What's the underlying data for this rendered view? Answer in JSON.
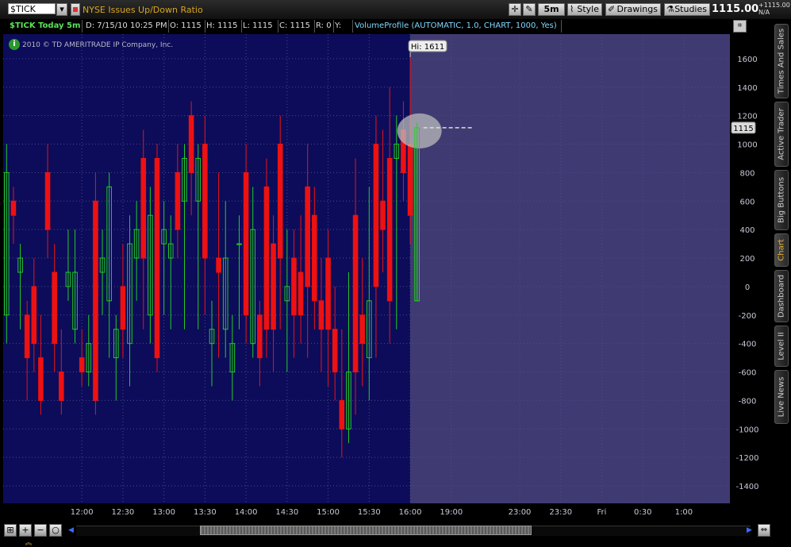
{
  "topbar": {
    "symbol": "$TICK",
    "study_title": "NYSE Issues Up/Down Ratio",
    "period_button": "5m",
    "style_button": "Style",
    "drawings_button": "Drawings",
    "studies_button": "Studies",
    "last_price": "1115.00",
    "change": "+1115.00",
    "change_pct": "N/A"
  },
  "infobar": {
    "title": "$TICK Today 5m",
    "date": "D: 7/15/10 10:25 PM",
    "open": "O: 1115",
    "high": "H: 1115",
    "low": "L: 1115",
    "close": "C: 1115",
    "range": "R: 0",
    "y": "Y:",
    "study": "VolumeProfile (AUTOMATIC, 1.0, CHART, 1000, Yes)"
  },
  "chart": {
    "copyright": "2010 © TD AMERITRADE IP Company, Inc.",
    "hi_label": "Hi: 1611",
    "price_badge": "1115",
    "colors": {
      "background": "#0c0c5a",
      "future": "#3f3b72",
      "up": "#22cc22",
      "down": "#ee1111",
      "axis_text": "#c8c8d8"
    }
  },
  "chart_data": {
    "type": "candlestick",
    "ylim": [
      -1500,
      1750
    ],
    "y_ticks": [
      1600,
      1400,
      1200,
      1000,
      800,
      600,
      400,
      200,
      0,
      -200,
      -400,
      -600,
      -800,
      -1000,
      -1200,
      -1400
    ],
    "x_ticks": [
      {
        "label": "12:00",
        "slot": 11
      },
      {
        "label": "12:30",
        "slot": 17
      },
      {
        "label": "13:00",
        "slot": 23
      },
      {
        "label": "13:30",
        "slot": 29
      },
      {
        "label": "14:00",
        "slot": 35
      },
      {
        "label": "14:30",
        "slot": 41
      },
      {
        "label": "15:00",
        "slot": 47
      },
      {
        "label": "15:30",
        "slot": 53
      },
      {
        "label": "16:00",
        "slot": 59
      },
      {
        "label": "19:00",
        "slot": 65
      },
      {
        "label": "23:00",
        "slot": 75
      },
      {
        "label": "23:30",
        "slot": 81
      },
      {
        "label": "Fri",
        "slot": 87
      },
      {
        "label": "0:30",
        "slot": 93
      },
      {
        "label": "1:00",
        "slot": 99
      }
    ],
    "session_end_slot": 59.5,
    "total_slots": 106,
    "hi": 1611,
    "last": 1115,
    "candles": [
      [
        -200,
        800,
        -400,
        1000
      ],
      [
        600,
        500,
        300,
        700
      ],
      [
        100,
        200,
        -300,
        300
      ],
      [
        -200,
        -500,
        -800,
        -100
      ],
      [
        0,
        -400,
        -600,
        200
      ],
      [
        -500,
        -800,
        -900,
        -200
      ],
      [
        800,
        400,
        200,
        1000
      ],
      [
        100,
        -400,
        -600,
        300
      ],
      [
        -600,
        -800,
        -900,
        -300
      ],
      [
        0,
        100,
        -100,
        400
      ],
      [
        -300,
        100,
        -400,
        400
      ],
      [
        -500,
        -600,
        -700,
        -300
      ],
      [
        -600,
        -400,
        -700,
        -200
      ],
      [
        600,
        -800,
        -900,
        800
      ],
      [
        100,
        200,
        -200,
        400
      ],
      [
        -100,
        700,
        -500,
        800
      ],
      [
        -500,
        -300,
        -800,
        -200
      ],
      [
        0,
        -300,
        -500,
        300
      ],
      [
        -400,
        300,
        -700,
        500
      ],
      [
        200,
        400,
        -100,
        600
      ],
      [
        900,
        200,
        -300,
        1100
      ],
      [
        -200,
        500,
        -400,
        700
      ],
      [
        900,
        -500,
        -600,
        1000
      ],
      [
        300,
        400,
        -200,
        600
      ],
      [
        200,
        300,
        -300,
        500
      ],
      [
        800,
        400,
        200,
        1000
      ],
      [
        600,
        900,
        -300,
        1000
      ],
      [
        1200,
        800,
        500,
        1300
      ],
      [
        600,
        900,
        -300,
        1000
      ],
      [
        1000,
        200,
        -200,
        1200
      ],
      [
        -400,
        -300,
        -700,
        -100
      ],
      [
        200,
        100,
        -500,
        800
      ],
      [
        -300,
        200,
        -500,
        600
      ],
      [
        -600,
        -400,
        -800,
        -200
      ],
      [
        300,
        300,
        -300,
        500
      ],
      [
        800,
        -200,
        -400,
        1000
      ],
      [
        -400,
        400,
        -500,
        700
      ],
      [
        -200,
        -500,
        -700,
        -100
      ],
      [
        700,
        -300,
        -500,
        900
      ],
      [
        300,
        -300,
        -600,
        500
      ],
      [
        1000,
        200,
        -300,
        1200
      ],
      [
        -100,
        0,
        -600,
        400
      ],
      [
        200,
        -200,
        -500,
        400
      ],
      [
        100,
        -200,
        -400,
        500
      ],
      [
        700,
        0,
        -500,
        1000
      ],
      [
        500,
        -100,
        -300,
        700
      ],
      [
        -100,
        -300,
        -600,
        200
      ],
      [
        200,
        -300,
        -700,
        400
      ],
      [
        -300,
        -600,
        -800,
        0
      ],
      [
        -800,
        -1000,
        -1200,
        -300
      ],
      [
        -1000,
        -600,
        -1100,
        100
      ],
      [
        500,
        -600,
        -900,
        900
      ],
      [
        -200,
        -400,
        -700,
        200
      ],
      [
        -500,
        -100,
        -800,
        700
      ],
      [
        1000,
        0,
        -500,
        1200
      ],
      [
        600,
        400,
        100,
        1100
      ],
      [
        900,
        -100,
        -400,
        1400
      ],
      [
        900,
        1000,
        -300,
        1200
      ],
      [
        1100,
        800,
        600,
        1300
      ],
      [
        1000,
        500,
        300,
        1611
      ],
      [
        -100,
        1115,
        -100,
        1150
      ]
    ]
  },
  "sidetabs": [
    "Times And Sales",
    "Active Trader",
    "Big Buttons",
    "Chart",
    "Dashboard",
    "Level II",
    "Live News"
  ],
  "sidetab_active": "Chart",
  "bottombar": {
    "zoom_in": "+",
    "zoom_out": "−",
    "fit": "○"
  }
}
